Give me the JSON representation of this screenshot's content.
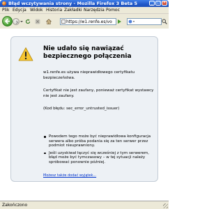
{
  "window": {
    "title": "Błąd wczytywania strony - Mozilla Firefox 3 Beta 5",
    "minimize": "_",
    "maximize": "□",
    "close": "×"
  },
  "menu": [
    "Plik",
    "Edycja",
    "Widok",
    "Historia",
    "Zakładki",
    "Narzędzia",
    "Pomoc"
  ],
  "navbar": {
    "url": "https://w1.renfe.es/vol/"
  },
  "error": {
    "title": "Nie udało się nawiązać bezpiecznego połączenia",
    "p1": "w1.renfe.es używa nieprawidłowego certyfikatu bezpieczeństwa.",
    "p2": "Certyfikat nie jest zaufany, ponieważ certyfikat wystawcy nie jest zaufany.",
    "p3": "(Kod błędu: sec_error_untrusted_issuer)",
    "bullets": [
      "Powodem tego może być nieprawidłowa konfiguracja serwera albo próba podania się za ten serwer przez podmiot nieuprawniony.",
      "Jeśli uzyskiwał łączyć się wcześniej z tym serwerem, błąd może być tymczasowy – w tej sytuacji należy spróbować ponownie później."
    ],
    "exception_link": "Możesz także dodać wyjątek..."
  },
  "status": {
    "text": "Zakończono"
  },
  "colors": {
    "titlebar": "#2258c9",
    "chrome": "#ece9d8",
    "error_box": "#edf1f5",
    "warning": "#f7c631",
    "link": "#0033cc"
  }
}
